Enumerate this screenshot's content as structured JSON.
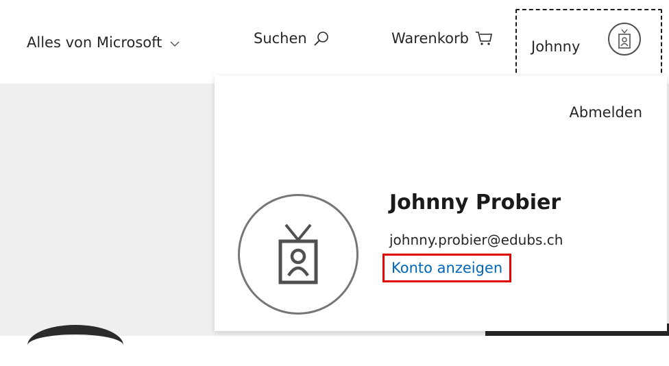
{
  "header": {
    "all_microsoft_label": "Alles von Microsoft",
    "search_label": "Suchen",
    "cart_label": "Warenkorb",
    "account_short_name": "Johnny"
  },
  "account_panel": {
    "sign_out_label": "Abmelden",
    "full_name": "Johnny Probier",
    "email": "johnny.probier@edubs.ch",
    "view_account_label": "Konto anzeigen"
  },
  "colors": {
    "link": "#0067b8",
    "highlight_border": "#e00000",
    "hero_background": "#efefef"
  },
  "icons": [
    "chevron-down-icon",
    "search-icon",
    "cart-icon",
    "badge-avatar-icon"
  ]
}
